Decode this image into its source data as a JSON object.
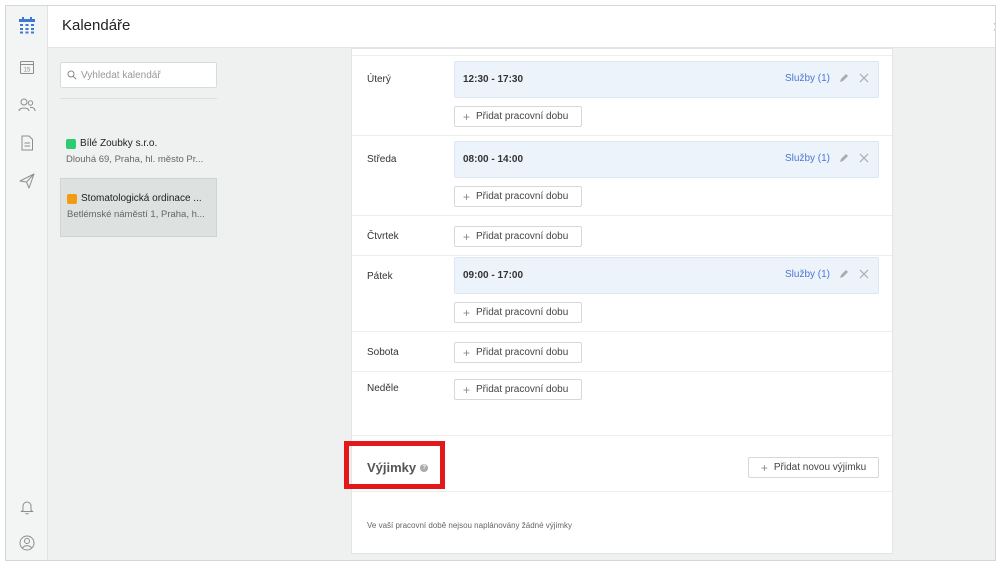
{
  "app": {
    "title": "Kalendáře"
  },
  "rail": {
    "icons": [
      "calendar-app-icon",
      "calendar-day-icon",
      "users-icon",
      "document-icon",
      "send-icon",
      "bell-icon",
      "account-icon"
    ],
    "calendar_day_number": "15",
    "brand_color": "#3a78d8"
  },
  "search": {
    "placeholder": "Vyhledat kalendář",
    "value": ""
  },
  "calendars": [
    {
      "name": "Bílé Zoubky s.r.o.",
      "address": "Dlouhá 69, Praha, hl. město Pr...",
      "color": "#2ecc71",
      "active": false
    },
    {
      "name": "Stomatologická ordinace ...",
      "address": "Betlémské náměstí 1, Praha, h...",
      "color": "#f39c12",
      "active": true
    }
  ],
  "schedule": {
    "days": {
      "tue": {
        "label": "Úterý",
        "slot": "12:30 - 17:30",
        "services": "Služby (1)"
      },
      "wed": {
        "label": "Středa",
        "slot": "08:00 - 14:00",
        "services": "Služby (1)"
      },
      "thu": {
        "label": "Čtvrtek"
      },
      "fri": {
        "label": "Pátek",
        "slot": "09:00 - 17:00",
        "services": "Služby (1)"
      },
      "sat": {
        "label": "Sobota"
      },
      "sun": {
        "label": "Neděle"
      }
    },
    "add_label": "Přidat pracovní dobu"
  },
  "exceptions": {
    "title": "Výjimky",
    "info_symbol": "?",
    "add_label": "Přidat novou výjimku",
    "empty_text": "Ve vaší pracovní době nejsou naplánovány žádné výjimky",
    "highlight_color": "#e4171b"
  },
  "colors": {
    "slot_bg": "#edf3fb",
    "link": "#4a78d0"
  }
}
